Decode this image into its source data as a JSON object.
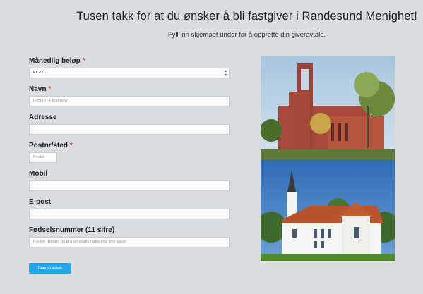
{
  "header": {
    "title": "Tusen takk for at du ønsker å bli fastgiver i Randesund Menighet!",
    "subtitle": "Fyll inn skjemaet under for å opprette din giveravtale."
  },
  "form": {
    "amount": {
      "label": "Månedlig beløp",
      "required_mark": "*",
      "value": "Kr 200,-"
    },
    "name": {
      "label": "Navn",
      "required_mark": "*",
      "placeholder": "Fornavn + Etternavn"
    },
    "address": {
      "label": "Adresse",
      "value": ""
    },
    "postal": {
      "label": "Postnr/sted",
      "required_mark": "*",
      "placeholder": "Postnr"
    },
    "mobile": {
      "label": "Mobil",
      "value": ""
    },
    "email": {
      "label": "E-post",
      "value": ""
    },
    "ssn": {
      "label": "Fødselsnummer (11 sifre)",
      "placeholder": "Fyll inn dersom du ønsker skattefradrag for dine gaver"
    },
    "submit_label": "Opprett avtale"
  },
  "colors": {
    "background": "#d9dde0",
    "required": "#d62b2b",
    "button": "#26a6e6"
  },
  "icons": {
    "select_arrow": "select-arrows-icon"
  }
}
